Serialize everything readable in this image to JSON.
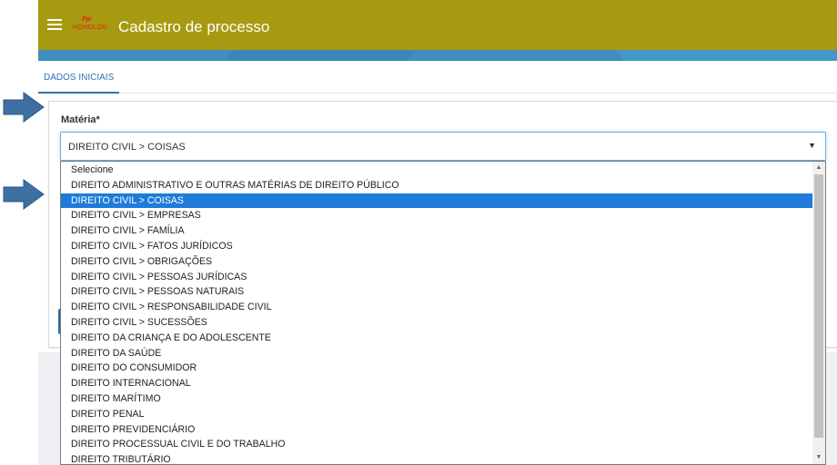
{
  "header": {
    "logo_top": "Pje",
    "logo_bottom": "HOMOLOG",
    "title": "Cadastro de processo",
    "bar_color": "#a79a10"
  },
  "tabs": [
    {
      "label": "DADOS INICIAIS",
      "active": true
    }
  ],
  "form": {
    "materia_label": "Matéria*",
    "materia_value": "DIREITO CIVIL > COISAS",
    "options": [
      "Selecione",
      "DIREITO ADMINISTRATIVO E OUTRAS MATÉRIAS DE DIREITO PÚBLICO",
      "DIREITO CIVIL > COISAS",
      "DIREITO CIVIL > EMPRESAS",
      "DIREITO CIVIL > FAMÍLIA",
      "DIREITO CIVIL > FATOS JURÍDICOS",
      "DIREITO CIVIL > OBRIGAÇÕES",
      "DIREITO CIVIL > PESSOAS JURÍDICAS",
      "DIREITO CIVIL > PESSOAS NATURAIS",
      "DIREITO CIVIL > RESPONSABILIDADE CIVIL",
      "DIREITO CIVIL > SUCESSÕES",
      "DIREITO DA CRIANÇA E DO ADOLESCENTE",
      "DIREITO DA SAÚDE",
      "DIREITO DO CONSUMIDOR",
      "DIREITO INTERNACIONAL",
      "DIREITO MARÍTIMO",
      "DIREITO PENAL",
      "DIREITO PREVIDENCIÁRIO",
      "DIREITO PROCESSUAL CIVIL E DO TRABALHO",
      "DIREITO TRIBUTÁRIO"
    ],
    "selected_index": 2
  },
  "icons": {
    "menu": "hamburger-menu-icon",
    "caret": "dropdown-caret-icon",
    "pointer": "blue-arrow-icon"
  },
  "colors": {
    "accent": "#2a74b8",
    "selection": "#1e7bd9",
    "pointer_arrow": "#3d6fa3"
  }
}
